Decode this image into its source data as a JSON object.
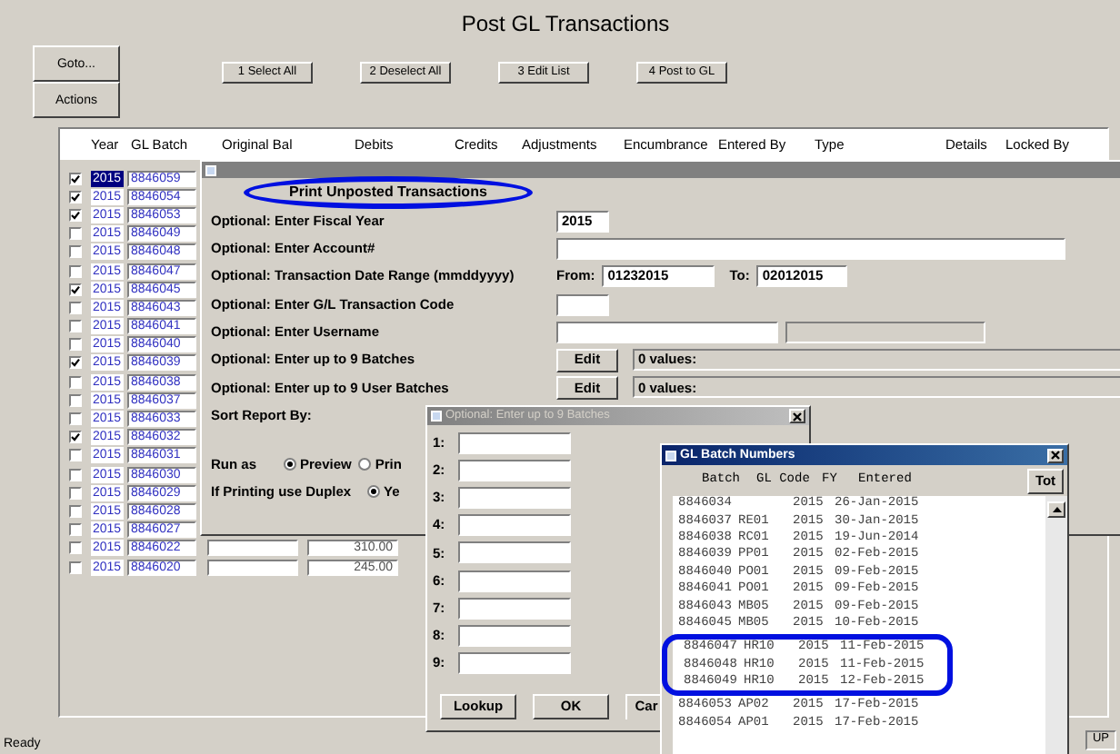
{
  "window": {
    "title": "Post GL Transactions"
  },
  "side_buttons": [
    "Goto...",
    "Actions"
  ],
  "toolbar": [
    "1 Select All",
    "2 Deselect All",
    "3 Edit List",
    "4 Post to GL"
  ],
  "columns": [
    "Year",
    "GL Batch",
    "Original Bal",
    "Debits",
    "Credits",
    "Adjustments",
    "Encumbrance",
    "Entered By",
    "Type",
    "Details",
    "Locked By"
  ],
  "rows": [
    {
      "checked": true,
      "selected": true,
      "year": "2015",
      "batch": "8846059"
    },
    {
      "checked": true,
      "selected": false,
      "year": "2015",
      "batch": "8846054"
    },
    {
      "checked": true,
      "selected": false,
      "year": "2015",
      "batch": "8846053"
    },
    {
      "checked": false,
      "selected": false,
      "year": "2015",
      "batch": "8846049"
    },
    {
      "checked": false,
      "selected": false,
      "year": "2015",
      "batch": "8846048"
    },
    {
      "checked": false,
      "selected": false,
      "year": "2015",
      "batch": "8846047"
    },
    {
      "checked": true,
      "selected": false,
      "year": "2015",
      "batch": "8846045"
    },
    {
      "checked": false,
      "selected": false,
      "year": "2015",
      "batch": "8846043"
    },
    {
      "checked": false,
      "selected": false,
      "year": "2015",
      "batch": "8846041"
    },
    {
      "checked": false,
      "selected": false,
      "year": "2015",
      "batch": "8846040"
    },
    {
      "checked": true,
      "selected": false,
      "year": "2015",
      "batch": "8846039"
    },
    {
      "checked": false,
      "selected": false,
      "year": "2015",
      "batch": "8846038"
    },
    {
      "checked": false,
      "selected": false,
      "year": "2015",
      "batch": "8846037"
    },
    {
      "checked": false,
      "selected": false,
      "year": "2015",
      "batch": "8846033"
    },
    {
      "checked": true,
      "selected": false,
      "year": "2015",
      "batch": "8846032"
    },
    {
      "checked": false,
      "selected": false,
      "year": "2015",
      "batch": "8846031"
    },
    {
      "checked": false,
      "selected": false,
      "year": "2015",
      "batch": "8846030"
    },
    {
      "checked": false,
      "selected": false,
      "year": "2015",
      "batch": "8846029"
    },
    {
      "checked": false,
      "selected": false,
      "year": "2015",
      "batch": "8846028"
    },
    {
      "checked": false,
      "selected": false,
      "year": "2015",
      "batch": "8846027"
    },
    {
      "checked": false,
      "selected": false,
      "year": "2015",
      "batch": "8846022",
      "debits": "310.00"
    },
    {
      "checked": false,
      "selected": false,
      "year": "2015",
      "batch": "8846020",
      "debits": "245.00"
    }
  ],
  "status_bar": {
    "text": "Ready",
    "right": "UP"
  },
  "task_dialog": {
    "heading": "Print Unposted Transactions",
    "heading_circled": true,
    "fields": [
      {
        "kind": "short",
        "label": "Optional: Enter Fiscal Year",
        "value": "2015"
      },
      {
        "kind": "wide",
        "label": "Optional: Enter Account#"
      },
      {
        "kind": "range",
        "label": "Optional: Transaction Date Range (mmddyyyy)",
        "from_label": "From:",
        "from": "01232015",
        "to_label": "To:",
        "to": "02012015"
      },
      {
        "kind": "short",
        "label": "Optional: Enter G/L Transaction Code"
      },
      {
        "kind": "pair",
        "label": "Optional:  Enter Username"
      },
      {
        "kind": "edit",
        "label": "Optional: Enter up to 9 Batches",
        "button": "Edit",
        "summary": "0 values:"
      },
      {
        "kind": "edit",
        "label": "Optional: Enter up to 9 User Batches",
        "button": "Edit",
        "summary": "0 values:"
      },
      {
        "kind": "plain",
        "label": "Sort Report By:"
      },
      {
        "kind": "radio",
        "label": "Run as",
        "options": [
          {
            "label": "Preview",
            "selected": true
          },
          {
            "label": "Prin",
            "selected": false
          }
        ]
      },
      {
        "kind": "radio",
        "label": "If Printing use Duplex",
        "options": [
          {
            "label": "Ye",
            "selected": true
          }
        ]
      }
    ]
  },
  "batch_dialog": {
    "title": "Optional: Enter up to 9 Batches",
    "slots": [
      "1:",
      "2:",
      "3:",
      "4:",
      "5:",
      "6:",
      "7:",
      "8:",
      "9:"
    ],
    "buttons": [
      "Lookup",
      "OK",
      "Car"
    ]
  },
  "gl_batch_window": {
    "title": "GL Batch Numbers",
    "columns": [
      "Batch",
      "GL Code",
      "FY",
      "Entered"
    ],
    "total_button": "Tot",
    "rows": [
      {
        "batch": "8846034",
        "fy": "2015",
        "entered": "26-Jan-2015",
        "circled": false
      },
      {
        "batch": "8846037",
        "code": "RE01",
        "fy": "2015",
        "entered": "30-Jan-2015",
        "circled": false
      },
      {
        "batch": "8846038",
        "code": "RC01",
        "fy": "2015",
        "entered": "19-Jun-2014",
        "circled": false
      },
      {
        "batch": "8846039",
        "code": "PP01",
        "fy": "2015",
        "entered": "02-Feb-2015",
        "circled": false
      },
      {
        "batch": "8846040",
        "code": "PO01",
        "fy": "2015",
        "entered": "09-Feb-2015",
        "circled": false
      },
      {
        "batch": "8846041",
        "code": "PO01",
        "fy": "2015",
        "entered": "09-Feb-2015",
        "circled": false
      },
      {
        "batch": "8846043",
        "code": "MB05",
        "fy": "2015",
        "entered": "09-Feb-2015",
        "circled": false
      },
      {
        "batch": "8846045",
        "code": "MB05",
        "fy": "2015",
        "entered": "10-Feb-2015",
        "circled": false
      },
      {
        "batch": "8846047",
        "code": "HR10",
        "fy": "2015",
        "entered": "11-Feb-2015",
        "circled": true
      },
      {
        "batch": "8846048",
        "code": "HR10",
        "fy": "2015",
        "entered": "11-Feb-2015",
        "circled": true
      },
      {
        "batch": "8846049",
        "code": "HR10",
        "fy": "2015",
        "entered": "12-Feb-2015",
        "circled": true
      },
      {
        "batch": "8846053",
        "code": "AP02",
        "fy": "2015",
        "entered": "17-Feb-2015",
        "circled": false
      },
      {
        "batch": "8846054",
        "code": "AP01",
        "fy": "2015",
        "entered": "17-Feb-2015",
        "circled": false
      }
    ]
  }
}
